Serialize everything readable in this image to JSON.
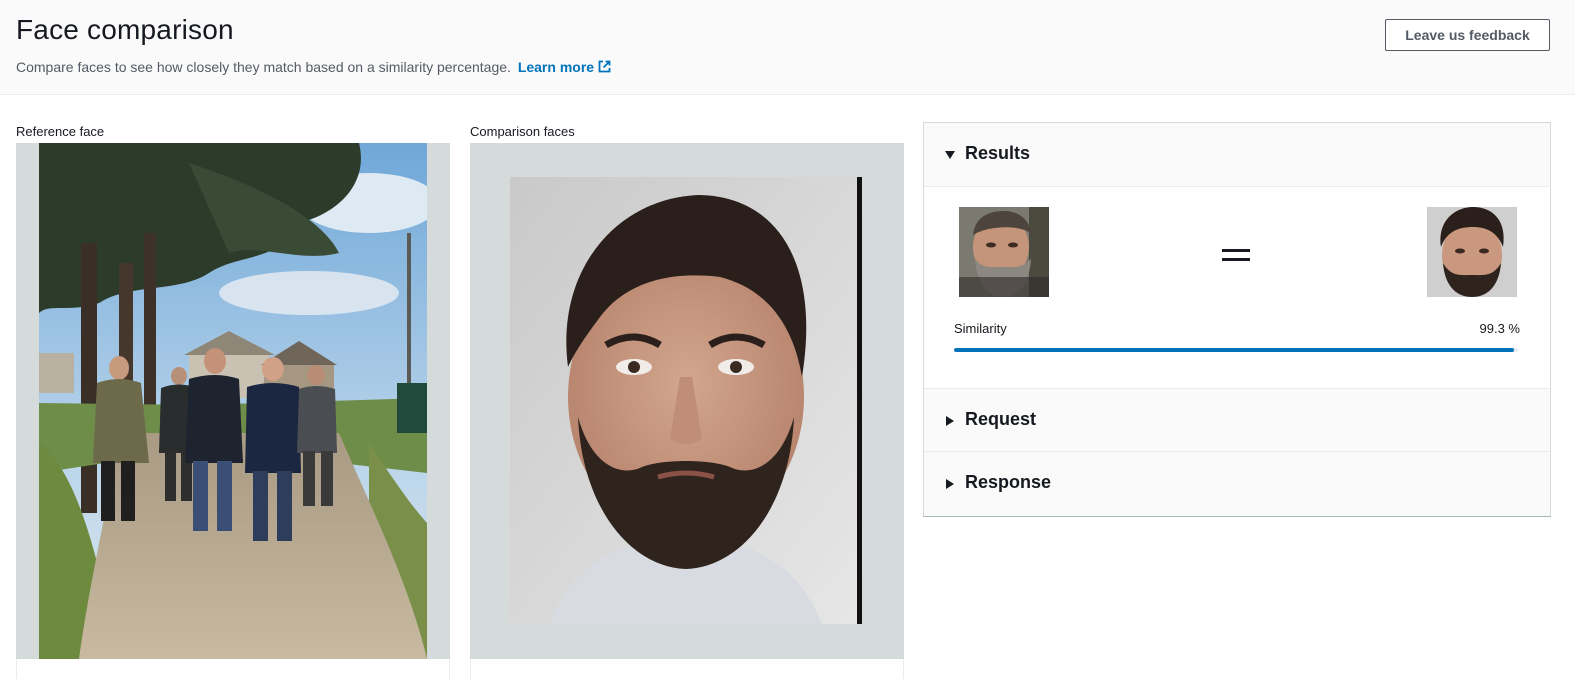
{
  "header": {
    "title": "Face comparison",
    "description": "Compare faces to see how closely they match based on a similarity percentage.",
    "learn_more": "Learn more",
    "feedback_label": "Leave us feedback"
  },
  "reference": {
    "label": "Reference face"
  },
  "comparison": {
    "label": "Comparison faces"
  },
  "results": {
    "title": "Results",
    "similarity_label": "Similarity",
    "similarity_text": "99.3 %",
    "similarity_fraction": 0.993
  },
  "request": {
    "title": "Request"
  },
  "response": {
    "title": "Response"
  },
  "colors": {
    "accent": "#0073bb",
    "image_frame": "#d5dbdb",
    "panel_header": "#fafafa"
  }
}
